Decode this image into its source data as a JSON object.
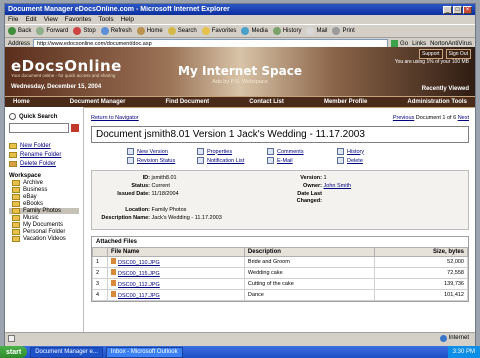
{
  "window": {
    "title": "Document Manager eDocsOnline.com - Microsoft Internet Explorer",
    "menus": [
      "File",
      "Edit",
      "View",
      "Favorites",
      "Tools",
      "Help"
    ],
    "toolbar": [
      "Back",
      "Forward",
      "Stop",
      "Refresh",
      "Home",
      "Search",
      "Favorites",
      "Media",
      "History",
      "Mail",
      "Print"
    ],
    "address_label": "Address",
    "address_value": "http://www.edocsonline.com/document/doc.asp",
    "go_label": "Go",
    "links_label": "Links",
    "extra_label": "NortonAntiVirus"
  },
  "header": {
    "logo": "eDocsOnline",
    "tagline": "Your document online - for quick access and sharing",
    "date": "Wednesday, December 15, 2004",
    "title": "My Internet Space",
    "subtitle": "Ads by P.S. Webspace",
    "space_info": "You are using 1% of your 100 MB",
    "top_links": [
      "Support",
      "Sign Out"
    ],
    "recent": "Recently Viewed"
  },
  "nav": [
    "Home",
    "Document Manager",
    "Find Document",
    "Contact List",
    "Member Profile",
    "Administration Tools"
  ],
  "sidebar": {
    "quick_search": "Quick Search",
    "folder_links": [
      "New Folder",
      "Rename Folder",
      "Delete Folder"
    ],
    "workspace_label": "Workspace",
    "tree": [
      {
        "label": "Archive",
        "selected": false
      },
      {
        "label": "Business",
        "selected": false
      },
      {
        "label": "eBay",
        "selected": false
      },
      {
        "label": "eBooks",
        "selected": false
      },
      {
        "label": "Family Photos",
        "selected": true
      },
      {
        "label": "Music",
        "selected": false
      },
      {
        "label": "My Documents",
        "selected": false
      },
      {
        "label": "Personal Folder",
        "selected": false
      },
      {
        "label": "Vacation Videos",
        "selected": false
      }
    ]
  },
  "doc": {
    "return_link": "Return to Navigator",
    "pager": {
      "prev": "Previous",
      "text": "Document 1 of 6",
      "next": "Next"
    },
    "title": "Document jsmith8.01  Version 1  Jack's Wedding - 11.17.2003",
    "actions": [
      "New Version",
      "Properties",
      "Comments",
      "History",
      "Revision Status",
      "Notification List",
      "E-Mail",
      "Delete"
    ],
    "meta": {
      "id_label": "ID:",
      "id_value": "jsmith8.01",
      "status_label": "Status:",
      "status_value": "Current",
      "issued_label": "Issued Date:",
      "issued_value": "11/18/2004",
      "location_label": "Location:",
      "location_value": "Family Photos",
      "desc_label": "Description Name:",
      "desc_value": "Jack's Wedding - 11.17.2003",
      "version_label": "Version:",
      "version_value": "1",
      "owner_label": "Owner:",
      "owner_value": "John Smith",
      "datelast_label": "Date Last",
      "changed_label": "Changed:"
    }
  },
  "attached": {
    "caption": "Attached Files",
    "headers": [
      "File Name",
      "Description",
      "Size, bytes"
    ],
    "rows": [
      {
        "num": "1",
        "name": "DSC00_110.JPG",
        "desc": "Bride and Groom",
        "size": "52,000"
      },
      {
        "num": "2",
        "name": "DSC00_115.JPG",
        "desc": "Wedding cake",
        "size": "72,558"
      },
      {
        "num": "3",
        "name": "DSC00_112.JPG",
        "desc": "Cutting of the cake",
        "size": "139,736"
      },
      {
        "num": "4",
        "name": "DSC00_117.JPG",
        "desc": "Dance",
        "size": "101,412"
      }
    ]
  },
  "statusbar": {
    "zone": "Internet"
  },
  "taskbar": {
    "start": "start",
    "tasks": [
      "Document Manager e...",
      "Inbox - Microsoft Outlook"
    ],
    "clock": "3:30 PM"
  }
}
